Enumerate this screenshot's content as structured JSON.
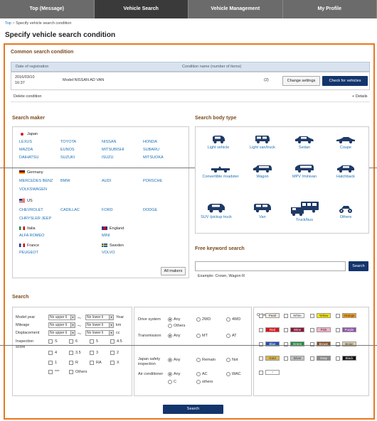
{
  "nav": {
    "items": [
      "Top (Message)",
      "Vehicle Search",
      "Vehicle Management",
      "My Profile"
    ]
  },
  "breadcrumb": {
    "top": "Top",
    "sep": ">",
    "current": "Specify vehicle search condition"
  },
  "page_title": "Specify vehicle search condition",
  "common": {
    "title": "Common search condition",
    "col_date": "Date of registration",
    "col_name": "Condition name (number of items)",
    "row_date": "2016/03/10",
    "row_time": "16:37",
    "row_model": "Model:NISSAN AD VAN",
    "row_count": "(2)",
    "change_btn": "Change settings",
    "check_btn": "Check for vehicles",
    "delete_link": "Delete condition",
    "details_link": "+ Details"
  },
  "maker": {
    "title": "Search maker",
    "japan": "Japan",
    "japan_makers": [
      "LEXUS",
      "TOYOTA",
      "NISSAN",
      "HONDA",
      "MAZDA",
      "EUNOS",
      "MITSUBISHI",
      "SUBARU",
      "DAIHATSU",
      "SUZUKI",
      "ISUZU",
      "MITSUOKA"
    ],
    "germany": "Germany",
    "germany_makers": [
      "MERCEDES BENZ",
      "BMW",
      "AUDI",
      "PORSCHE",
      "VOLKSWAGEN"
    ],
    "us": "US",
    "us_makers": [
      "CHEVROLET",
      "CADILLAC",
      "FORD",
      "DODGE",
      "CHRYSLER JEEP"
    ],
    "italy": "Italia",
    "italy_makers": [
      "ALFA ROMEO"
    ],
    "england": "England",
    "england_makers": [
      "MINI"
    ],
    "france": "France",
    "france_makers": [
      "PEUGEOT"
    ],
    "sweden": "Sweden",
    "sweden_makers": [
      "VOLVO"
    ],
    "all_btn": "All makers"
  },
  "body_type": {
    "title": "Search body type",
    "items": [
      "Light vehicle",
      "Light van/truck",
      "Sedan",
      "Coupe",
      "Convertible /roadster",
      "Wagon",
      "MPV /minivan",
      "Hatchback",
      "SUV /pickup truck",
      "Van",
      "Truck/bus",
      "Others"
    ]
  },
  "keyword": {
    "title": "Free keyword search",
    "value": "",
    "search_btn": "Search",
    "example": "Example: Crown, Wagon R"
  },
  "search": {
    "title": "Search",
    "model_year": "Model year",
    "mileage": "Mileage",
    "displacement": "Displacement",
    "inspection": "Inspection",
    "score": "score",
    "no_upper": "No upper li",
    "no_lower": "No lower li",
    "tilde": "～",
    "year_unit": "Year",
    "km_unit": "km",
    "cc_unit": "cc",
    "scores": [
      "S",
      "6",
      "5",
      "4.5",
      "4",
      "3.5",
      "3",
      "2",
      "1",
      "R",
      "RA",
      "X",
      "***",
      "Others"
    ],
    "drive": "Drive system",
    "drive_opts": [
      "Any",
      "2WD",
      "4WD",
      "Others"
    ],
    "trans": "Transmission",
    "trans_opts": [
      "Any",
      "MT",
      "AT"
    ],
    "safety": "Japan safety inspection",
    "safety_opts": [
      "Any",
      "Remain",
      "Not"
    ],
    "ac": "Air conditioner",
    "ac_opts": [
      "Any",
      "AC",
      "WAC",
      "C",
      "others"
    ],
    "color": "Color",
    "colors": [
      {
        "name": "Pearl",
        "bg": "#f3eee0",
        "fg": "#333"
      },
      {
        "name": "White",
        "bg": "#ffffff",
        "fg": "#333"
      },
      {
        "name": "Yellow",
        "bg": "#f5e600",
        "fg": "#333"
      },
      {
        "name": "Orange",
        "bg": "#f29b1c",
        "fg": "#333"
      },
      {
        "name": "Red",
        "bg": "#d8161b",
        "fg": "#fff"
      },
      {
        "name": "Wine",
        "bg": "#8b1538",
        "fg": "#fff"
      },
      {
        "name": "Pink",
        "bg": "#f6b3c8",
        "fg": "#333"
      },
      {
        "name": "Purple",
        "bg": "#8e4fa8",
        "fg": "#fff"
      },
      {
        "name": "Blue",
        "bg": "#1c4fb5",
        "fg": "#fff"
      },
      {
        "name": "Green",
        "bg": "#1c8d3a",
        "fg": "#fff"
      },
      {
        "name": "Brown",
        "bg": "#8a4b1e",
        "fg": "#fff"
      },
      {
        "name": "Beige",
        "bg": "#e4d1a8",
        "fg": "#333"
      },
      {
        "name": "Gold",
        "bg": "#d9b84a",
        "fg": "#333"
      },
      {
        "name": "Silver",
        "bg": "#c4c4c4",
        "fg": "#333"
      },
      {
        "name": "Gray",
        "bg": "#8a8a8a",
        "fg": "#fff"
      },
      {
        "name": "Black",
        "bg": "#111111",
        "fg": "#fff"
      },
      {
        "name": "?",
        "bg": "#ffffff",
        "fg": "#999"
      }
    ],
    "submit": "Search"
  }
}
